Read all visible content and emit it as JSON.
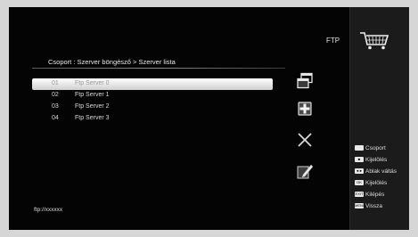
{
  "header": {
    "mode_label": "FTP",
    "breadcrumb": "Csoport : Szerver böngésző > Szerver lista"
  },
  "servers": [
    {
      "num": "01",
      "name": "Ftp Server 0",
      "selected": true
    },
    {
      "num": "02",
      "name": "Ftp Server 1",
      "selected": false
    },
    {
      "num": "03",
      "name": "Ftp Server 2",
      "selected": false
    },
    {
      "num": "04",
      "name": "Ftp Server 3",
      "selected": false
    }
  ],
  "actions": [
    {
      "icon": "copy-windows-icon"
    },
    {
      "icon": "add-plus-icon"
    },
    {
      "icon": "delete-x-icon"
    },
    {
      "icon": "edit-pencil-icon"
    }
  ],
  "legend": [
    {
      "key_icon": "white-key-icon",
      "key_text": "",
      "label": "Csoport"
    },
    {
      "key_icon": "select-key-icon",
      "key_text": "■",
      "label": "Kijelölés"
    },
    {
      "key_icon": "window-switch-key-icon",
      "key_text": "◄►",
      "label": "Ablak váltás"
    },
    {
      "key_icon": "ok-key-icon",
      "key_text": "OK",
      "label": "Kijelölés"
    },
    {
      "key_icon": "exit-key-icon",
      "key_text": "EXIT",
      "label": "Kilépés"
    },
    {
      "key_icon": "menu-key-icon",
      "key_text": "MENU",
      "label": "Vissza"
    }
  ],
  "footer": {
    "path": "ftp://xxxxxx"
  }
}
